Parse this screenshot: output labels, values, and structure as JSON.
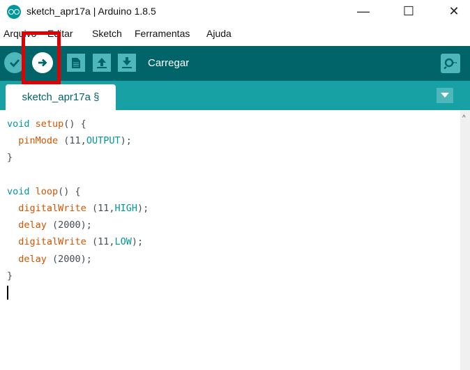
{
  "window": {
    "title": "sketch_apr17a | Arduino 1.8.5",
    "controls": {
      "minimize": "—",
      "maximize": "☐",
      "close": "✕"
    }
  },
  "menu": [
    "Arquivo",
    "Editar",
    "Sketch",
    "Ferramentas",
    "Ajuda"
  ],
  "toolbar": {
    "buttons": [
      "verify-icon",
      "upload-icon",
      "new-icon",
      "open-icon",
      "save-icon"
    ],
    "hover_label": "Carregar",
    "serial_monitor": "serial-monitor-icon",
    "highlighted_button": "upload"
  },
  "tabs": {
    "active": "sketch_apr17a §"
  },
  "editor": {
    "lines": [
      "void setup() {",
      "  pinMode (11,OUTPUT);",
      "}",
      "",
      "void loop() {",
      "  digitalWrite (11,HIGH);",
      "  delay (2000);",
      "  digitalWrite (11,LOW);",
      "  delay (2000);",
      "}"
    ]
  },
  "colors": {
    "toolbar": "#006468",
    "tabs_bar": "#17a1a5",
    "button": "#4db7bb",
    "highlight": "#e00000",
    "keyword": "#00979c",
    "function": "#d35400"
  }
}
